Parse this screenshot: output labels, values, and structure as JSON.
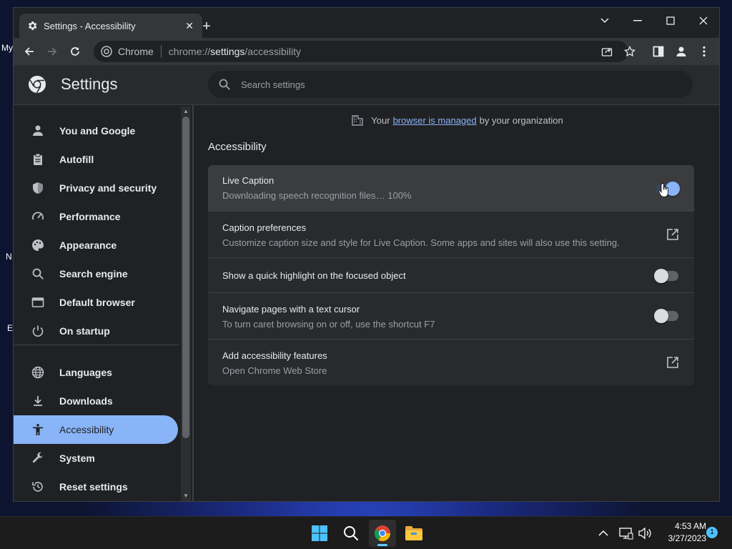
{
  "desktop": {
    "icon_labels": [
      "My",
      "N",
      "E"
    ]
  },
  "tab": {
    "title": "Settings - Accessibility"
  },
  "omnibox": {
    "chip": "Chrome",
    "url_prefix": "chrome://",
    "url_host": "settings",
    "url_path": "/accessibility"
  },
  "settings": {
    "title": "Settings",
    "search_placeholder": "Search settings"
  },
  "sidebar": {
    "items": [
      {
        "label": "You and Google",
        "icon": "person-icon"
      },
      {
        "label": "Autofill",
        "icon": "clipboard-icon"
      },
      {
        "label": "Privacy and security",
        "icon": "shield-icon"
      },
      {
        "label": "Performance",
        "icon": "speedometer-icon"
      },
      {
        "label": "Appearance",
        "icon": "palette-icon"
      },
      {
        "label": "Search engine",
        "icon": "search-icon"
      },
      {
        "label": "Default browser",
        "icon": "browser-icon"
      },
      {
        "label": "On startup",
        "icon": "power-icon"
      },
      {
        "label": "Languages",
        "icon": "globe-icon"
      },
      {
        "label": "Downloads",
        "icon": "download-icon"
      },
      {
        "label": "Accessibility",
        "icon": "accessibility-icon"
      },
      {
        "label": "System",
        "icon": "wrench-icon"
      },
      {
        "label": "Reset settings",
        "icon": "reset-icon"
      }
    ],
    "active": "Accessibility"
  },
  "managed": {
    "prefix": "Your",
    "link": "browser is managed",
    "suffix": "by your organization"
  },
  "section": {
    "title": "Accessibility"
  },
  "rows": [
    {
      "title": "Live Caption",
      "subtitle": "Downloading speech recognition files… 100%",
      "control": "toggle",
      "state": "on"
    },
    {
      "title": "Caption preferences",
      "subtitle": "Customize caption size and style for Live Caption. Some apps and sites will also use this setting.",
      "control": "external-link"
    },
    {
      "title": "Show a quick highlight on the focused object",
      "subtitle": "",
      "control": "toggle",
      "state": "off"
    },
    {
      "title": "Navigate pages with a text cursor",
      "subtitle": "To turn caret browsing on or off, use the shortcut F7",
      "control": "toggle",
      "state": "off"
    },
    {
      "title": "Add accessibility features",
      "subtitle": "Open Chrome Web Store",
      "control": "external-link"
    }
  ],
  "taskbar": {
    "time": "4:53 AM",
    "date": "3/27/2023",
    "notification_count": "1"
  },
  "colors": {
    "accent": "#8ab4f8",
    "background": "#202124",
    "card": "#292a2d"
  }
}
